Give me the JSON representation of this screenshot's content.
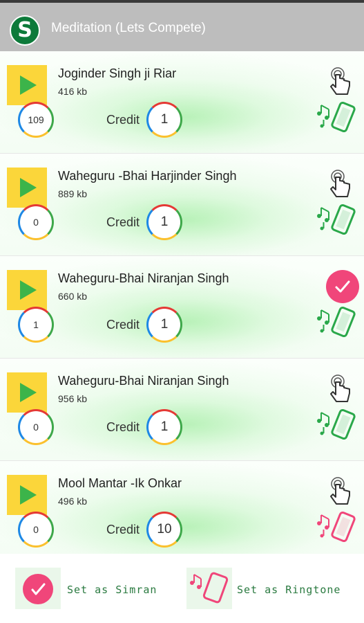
{
  "app": {
    "title": "Meditation (Lets Compete)",
    "logo_letter": "S"
  },
  "tracks": [
    {
      "title": "Joginder Singh ji Riar",
      "size": "416 kb",
      "count": "109",
      "credit_label": "Credit",
      "credit": "1",
      "status_icon": "tap-hand-icon",
      "ringtone_color": "#2aa84a"
    },
    {
      "title": "Waheguru -Bhai Harjinder Singh",
      "size": "889 kb",
      "count": "0",
      "credit_label": "Credit",
      "credit": "1",
      "status_icon": "tap-hand-icon",
      "ringtone_color": "#2aa84a"
    },
    {
      "title": "Waheguru-Bhai Niranjan Singh",
      "size": "660 kb",
      "count": "1",
      "credit_label": "Credit",
      "credit": "1",
      "status_icon": "check-icon",
      "ringtone_color": "#2aa84a"
    },
    {
      "title": "Waheguru-Bhai Niranjan Singh",
      "size": "956 kb",
      "count": "0",
      "credit_label": "Credit",
      "credit": "1",
      "status_icon": "tap-hand-icon",
      "ringtone_color": "#2aa84a"
    },
    {
      "title": "Mool Mantar -Ik Onkar",
      "size": "496 kb",
      "count": "0",
      "credit_label": "Credit",
      "credit": "10",
      "status_icon": "tap-hand-icon",
      "ringtone_color": "#f0467a"
    }
  ],
  "legend": {
    "simran_label": "Set as Simran",
    "ringtone_label": "Set as Ringtone"
  },
  "colors": {
    "app_bar": "#bdbdbd",
    "play_box": "#fbd63a",
    "play_icon": "#3cb44a",
    "simran_pink": "#f0467a",
    "ringtone_green": "#2aa84a",
    "ring_red": "#e53935",
    "ring_green": "#3ea84a",
    "ring_yellow": "#fbc02d",
    "ring_blue": "#1e88e5"
  }
}
